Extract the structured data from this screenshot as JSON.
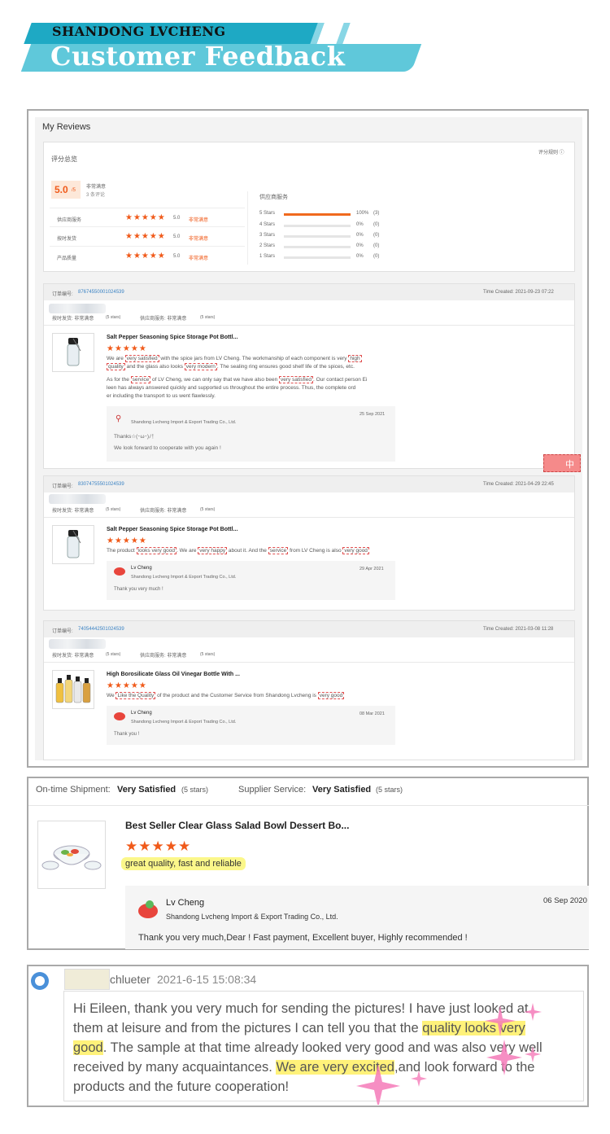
{
  "banner": {
    "brand": "SHANDONG LVCHENG",
    "title": "Customer Feedback"
  },
  "reviews_page": {
    "heading": "My Reviews",
    "summary": {
      "label": "评分总览",
      "rules_link": "评分规则 ⓘ",
      "score": "5.0",
      "score_suffix": "/5",
      "score_text": "非常满意",
      "count_text": "3 条评论",
      "rows": [
        {
          "label": "供应商服务",
          "stars": "★★★★★",
          "value": "5.0",
          "text": "非常满意"
        },
        {
          "label": "按时发货",
          "stars": "★★★★★",
          "value": "5.0",
          "text": "非常满意"
        },
        {
          "label": "产品质量",
          "stars": "★★★★★",
          "value": "5.0",
          "text": "非常满意"
        }
      ],
      "supplier_label": "供应商服务",
      "distribution": [
        {
          "label": "5 Stars",
          "pct": "100%",
          "count": "(3)",
          "fill": 1.0
        },
        {
          "label": "4 Stars",
          "pct": "0%",
          "count": "(0)",
          "fill": 0
        },
        {
          "label": "3 Stars",
          "pct": "0%",
          "count": "(0)",
          "fill": 0
        },
        {
          "label": "2 Stars",
          "pct": "0%",
          "count": "(0)",
          "fill": 0
        },
        {
          "label": "1 Stars",
          "pct": "0%",
          "count": "(0)",
          "fill": 0
        }
      ]
    },
    "orders": [
      {
        "order_label": "订单编号:",
        "order_no": "87674550001024539",
        "time": "Time Created: 2021-09-23 07:22",
        "ship": "按时发货: 非常满意",
        "ship_stars": "(5 stars)",
        "service": "供应商服务: 非常满意",
        "service_stars": "(5 stars)",
        "product": "Salt Pepper Seasoning Spice Storage Pot Bottl...",
        "stars": "★★★★★",
        "reply_date": "25 Sep 2021",
        "reply_company": "Shandong Lvcheng Import & Export Trading Co., Ltd.",
        "reply_line1": "Thanks☆(･ω･)ﾉ！",
        "reply_line2": "We look forward to cooperate with you again !"
      },
      {
        "order_label": "订单编号:",
        "order_no": "83074755501024539",
        "time": "Time Created: 2021-04-29 22:45",
        "ship": "按时发货: 非常满意",
        "ship_stars": "(5 stars)",
        "service": "供应商服务: 非常满意",
        "service_stars": "(5 stars)",
        "product": "Salt Pepper Seasoning Spice Storage Pot Bottl...",
        "stars": "★★★★★",
        "reply_name": "Lv Cheng",
        "reply_date": "29 Apr 2021",
        "reply_company": "Shandong Lvcheng Import & Export Trading Co., Ltd.",
        "reply_line1": "Thank you very much !"
      },
      {
        "order_label": "订单编号:",
        "order_no": "74054442501024539",
        "time": "Time Created: 2021-03-08 11:28",
        "ship": "按时发货: 非常满意",
        "ship_stars": "(5 stars)",
        "service": "供应商服务: 非常满意",
        "service_stars": "(5 stars)",
        "product": "High Borosilicate Glass Oil Vinegar Bottle With ...",
        "stars": "★★★★★",
        "reply_name": "Lv Cheng",
        "reply_date": "08 Mar 2021",
        "reply_company": "Shandong Lvcheng Import & Export Trading Co., Ltd.",
        "reply_line1": "Thank you !"
      }
    ],
    "review1": {
      "a1": "We are ",
      "h1": "very satisfied",
      "a2": " with the spice jars from LV Cheng. The workmanship of each component is very ",
      "h2": "high",
      "h3": "quality",
      "a3": " and the glass also looks ",
      "h4": "very modern",
      "a4": ". The sealing ring ensures good shelf life of the spices, etc.",
      "b1": "As for the ",
      "h5": "service",
      "b2": " of LV Cheng, we can only say that we have also been ",
      "h6": "very satisfied",
      "b3": ". Our contact person Ei",
      "b4": "leen has always answered quickly and supported us throughout the entire process. Thus, the complete ord",
      "b5": "er including the transport to us went flawlessly."
    },
    "review2": {
      "a1": "The product ",
      "h1": "looks very good",
      "a2": ". We are ",
      "h2": "very happy",
      "a3": " about it. And the ",
      "h3": "service",
      "a4": " from LV Cheng is also ",
      "h4": "very good"
    },
    "review3": {
      "a1": "We ",
      "h1": "Like the Quality",
      "a2": " of the product and the Customer Service from Shandong Lvcheng is ",
      "h2": "very good"
    }
  },
  "second_review": {
    "ship_label": "On-time Shipment: ",
    "ship_value": "Very Satisfied",
    "ship_stars": "(5 stars)",
    "service_label": "Supplier Service: ",
    "service_value": "Very Satisfied",
    "service_stars": "(5 stars)",
    "product": "Best Seller Clear Glass Salad Bowl Dessert Bo...",
    "stars": "★★★★★",
    "comment": "great quality, fast and reliable",
    "reply_name": "Lv Cheng",
    "reply_date": "06 Sep 2020",
    "reply_company": "Shandong Lvcheng Import & Export Trading Co., Ltd.",
    "reply_text": "Thank you very much,Dear ! Fast payment, Excellent buyer, Highly recommended !"
  },
  "chat": {
    "name": "chlueter",
    "time": "2021-6-15 15:08:34",
    "l1": "Hi Eileen, thank you very much for sending the pictures! I have just looked at",
    "l2a": "them at leisure and from the pictures I can tell you that the ",
    "l2b": "quality looks very",
    "l3a": "good",
    "l3b": ". The sample at that time already looked very good and was also very well",
    "l4a": "received by many acquaintances. ",
    "l4b": "We are very excited",
    "l4c": ",and look forward to the",
    "l5": "products and the future cooperation!"
  },
  "colors": {
    "accent": "#1ea9c4",
    "star": "#f05a1a",
    "highlight": "#fff27a"
  }
}
